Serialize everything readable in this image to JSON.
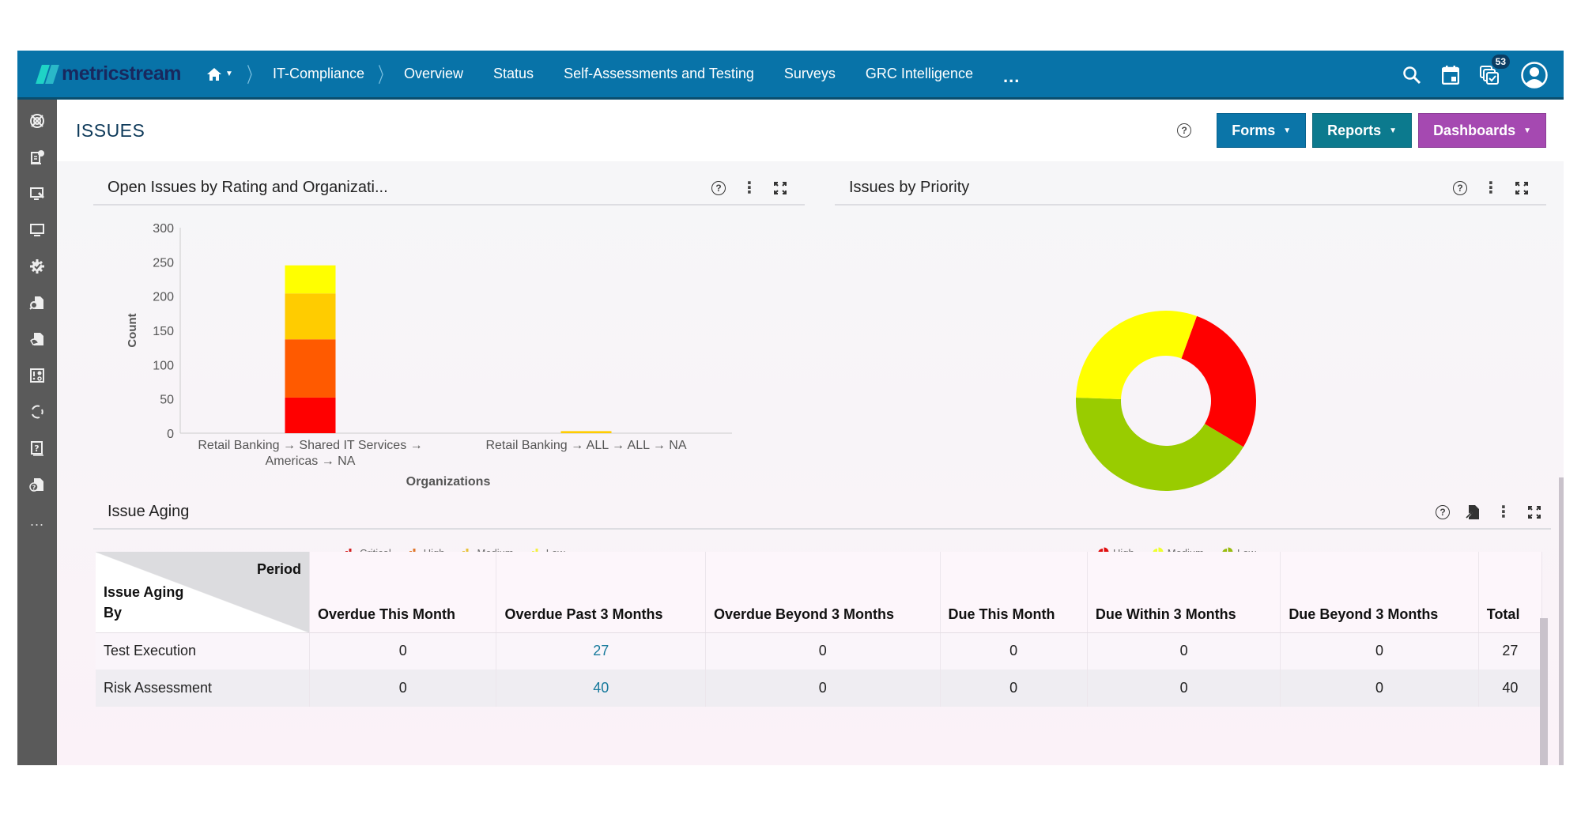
{
  "app": {
    "brand": "metricstream",
    "breadcrumb": [
      "IT-Compliance"
    ],
    "nav_items": [
      "Overview",
      "Status",
      "Self-Assessments and Testing",
      "Surveys",
      "GRC Intelligence"
    ],
    "nav_more": "...",
    "notification_count": "53",
    "accent_color": "#0873a8"
  },
  "sidebar": {
    "items": [
      {
        "icon": "target-icon"
      },
      {
        "icon": "document-check-icon"
      },
      {
        "icon": "monitor-tag-icon"
      },
      {
        "icon": "monitor-icon"
      },
      {
        "icon": "gear-check-icon"
      },
      {
        "icon": "document-search-icon"
      },
      {
        "icon": "document-hand-icon"
      },
      {
        "icon": "alert-settings-icon"
      },
      {
        "icon": "cycle-icon"
      },
      {
        "icon": "question-document-icon"
      },
      {
        "icon": "document-question-icon"
      }
    ],
    "more": "..."
  },
  "page": {
    "title": "ISSUES",
    "help": "?",
    "buttons": {
      "forms": "Forms",
      "reports": "Reports",
      "dashboards": "Dashboards"
    }
  },
  "panels": {
    "rating_org": {
      "title": "Open Issues by Rating and Organizati..."
    },
    "priority": {
      "title": "Issues by Priority"
    },
    "aging": {
      "title": "Issue Aging"
    }
  },
  "chart_data": [
    {
      "type": "bar",
      "stacked": true,
      "title": "Open Issues by Rating and Organizati...",
      "xlabel": "Organizations",
      "ylabel": "Count",
      "ylim": [
        0,
        300
      ],
      "yticks": [
        0,
        50,
        100,
        150,
        200,
        250,
        300
      ],
      "categories": [
        [
          "Retail Banking → Shared IT Services →",
          "Americas → NA"
        ],
        [
          "Retail Banking → ALL → ALL → NA"
        ]
      ],
      "series": [
        {
          "name": "Critical",
          "color": "#ff0000",
          "values": [
            52,
            0
          ]
        },
        {
          "name": "High",
          "color": "#ff5a00",
          "values": [
            85,
            0
          ]
        },
        {
          "name": "Medium",
          "color": "#ffcc00",
          "values": [
            67,
            3
          ]
        },
        {
          "name": "Low",
          "color": "#ffff00",
          "values": [
            41,
            0
          ]
        }
      ],
      "legend_position": "bottom",
      "grid": false
    },
    {
      "type": "pie",
      "donut": true,
      "title": "Issues by Priority",
      "slices": [
        {
          "name": "High",
          "color": "#ff0000",
          "percent": 28
        },
        {
          "name": "Low",
          "color": "#99cc00",
          "percent": 42
        },
        {
          "name": "Medium",
          "color": "#ffff00",
          "percent": 30
        }
      ],
      "start_angle_deg": 20,
      "legend": [
        "High",
        "Medium",
        "Low"
      ],
      "legend_colors": [
        "#e01010",
        "#eeff30",
        "#99bb10"
      ],
      "legend_position": "bottom"
    }
  ],
  "aging_table": {
    "corner_period": "Period",
    "corner_by": "Issue Aging By",
    "columns": [
      "Overdue This Month",
      "Overdue Past 3 Months",
      "Overdue Beyond 3 Months",
      "Due This Month",
      "Due Within 3 Months",
      "Due Beyond 3 Months",
      "Total"
    ],
    "rows": [
      {
        "label": "Test Execution",
        "values": [
          "0",
          "27",
          "0",
          "0",
          "0",
          "0",
          "27"
        ]
      },
      {
        "label": "Risk Assessment",
        "values": [
          "0",
          "40",
          "0",
          "0",
          "0",
          "0",
          "40"
        ]
      }
    ]
  }
}
